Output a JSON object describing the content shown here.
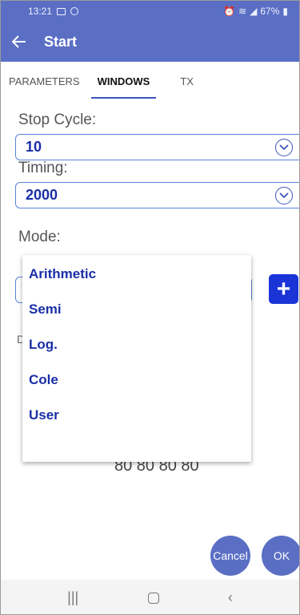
{
  "status_bar": {
    "time": "13:21",
    "battery": "67%"
  },
  "app_bar": {
    "title": "Start"
  },
  "tabs": [
    {
      "label": "PARAMETERS",
      "active": false
    },
    {
      "label": "WINDOWS",
      "active": true
    },
    {
      "label": "TX",
      "active": false
    }
  ],
  "stop_cycle": {
    "label": "Stop Cycle:",
    "value": "10"
  },
  "timing": {
    "label": "Timing:",
    "value": "2000"
  },
  "mode": {
    "label": "Mode:",
    "options": [
      "Arithmetic",
      "Semi",
      "Log.",
      "Cole",
      "User"
    ]
  },
  "partial": {
    "letter": "D",
    "values": "80 80 80 80"
  },
  "actions": {
    "cancel": "Cancel",
    "ok": "OK"
  },
  "colors": {
    "primary": "#5a6fc4",
    "accent": "#1a34d8",
    "value_text": "#1a2fa8"
  }
}
